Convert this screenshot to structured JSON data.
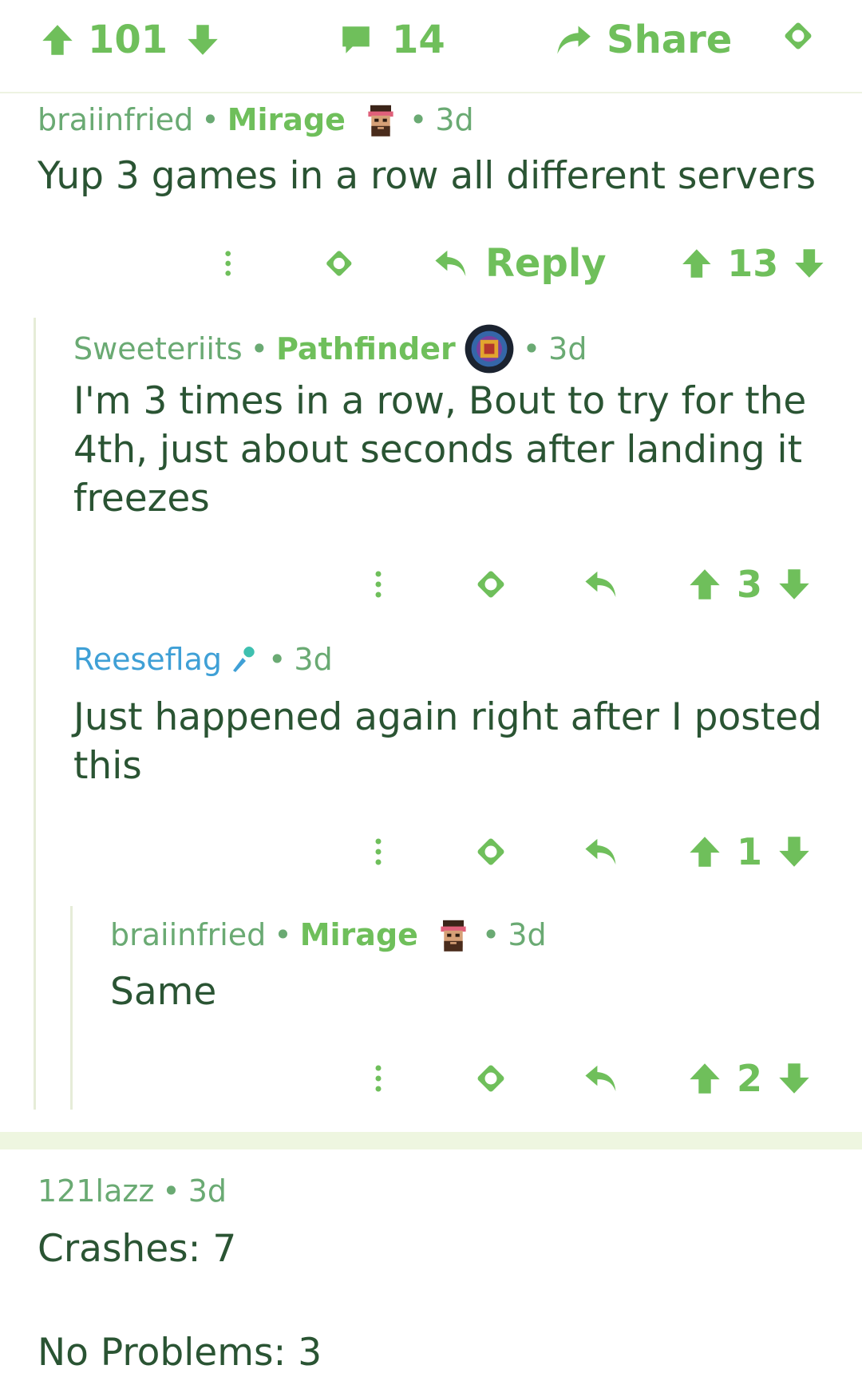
{
  "post_bar": {
    "upvotes": "101",
    "comments": "14",
    "share_label": "Share"
  },
  "comments": [
    {
      "user": "braiinfried",
      "flair": "Mirage",
      "time": "3d",
      "body": "Yup 3 games in a row all different servers",
      "reply_label": "Reply",
      "votes": "13"
    },
    {
      "user": "Sweeteriits",
      "flair": "Pathfinder",
      "time": "3d",
      "body": "I'm 3 times in a row, Bout to try for the 4th, just about seconds after landing it freezes",
      "votes": "3"
    },
    {
      "user": "Reeseflag",
      "time": "3d",
      "body": "Just happened again right after I posted this",
      "votes": "1"
    },
    {
      "user": "braiinfried",
      "flair": "Mirage",
      "time": "3d",
      "body": "Same",
      "votes": "2"
    },
    {
      "user": "121lazz",
      "time": "3d",
      "body_line1": "Crashes: 7",
      "body_line2": "No Problems: 3"
    }
  ],
  "icons": {
    "upvote": "arrow-up-icon",
    "downvote": "arrow-down-icon",
    "comment": "speech-bubble-icon",
    "share": "share-arrow-icon",
    "award": "award-icon",
    "reply": "reply-arrow-icon",
    "more": "vertical-dots-icon",
    "mod": "microphone-icon"
  },
  "colors": {
    "accent_green": "#6fbf5b",
    "text_dark_green": "#2a5433",
    "username_green": "#6aaa73",
    "mod_blue": "#3fa0d6",
    "mod_icon": "#3ec0b0"
  }
}
